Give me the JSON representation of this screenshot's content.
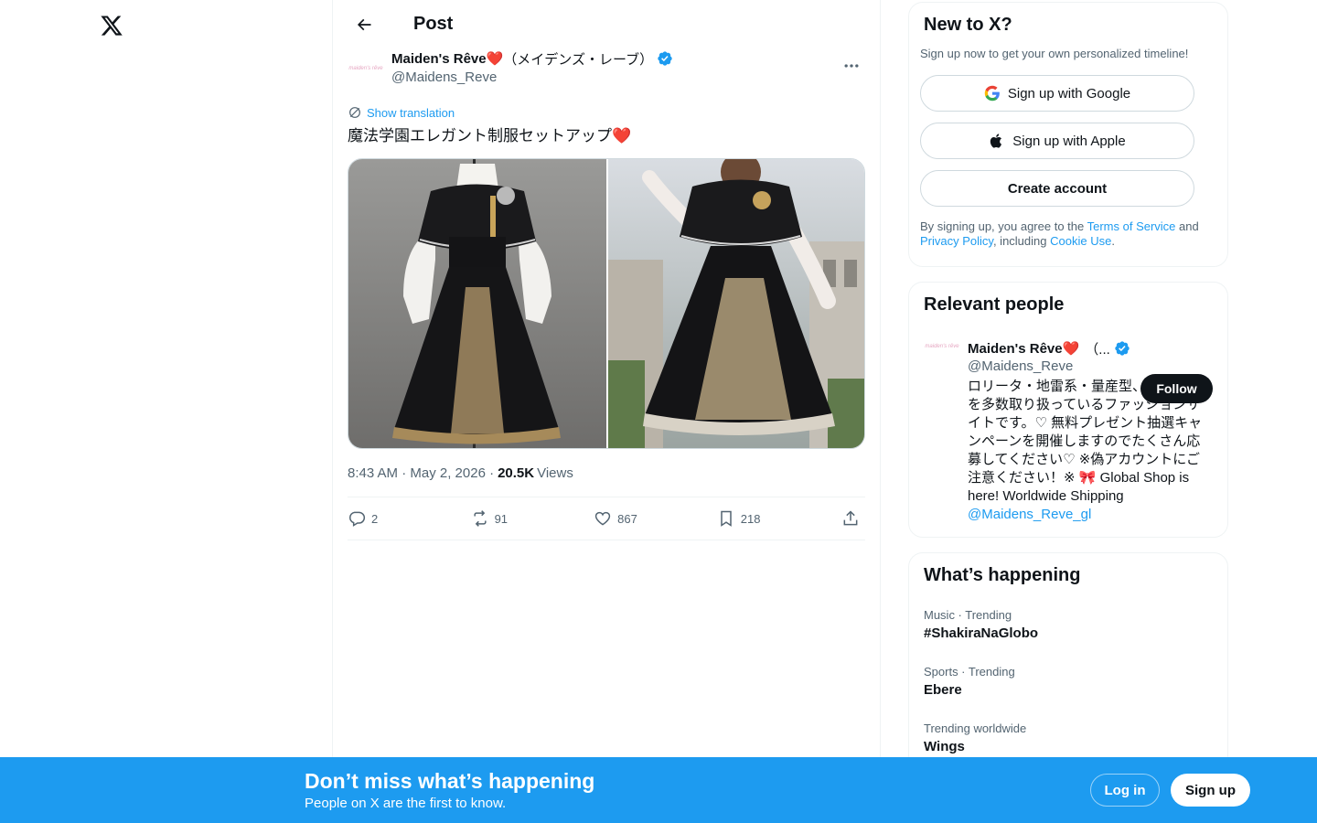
{
  "nav": {
    "logo_icon": "x-logo-icon"
  },
  "header": {
    "title": "Post",
    "back_icon": "arrow-left-icon"
  },
  "tweet": {
    "display_name": "Maiden's Rêve❤️",
    "display_name_suffix": "（メイデンズ・レーブ）",
    "handle": "@Maidens_Reve",
    "avatar_text": "maiden's rêve",
    "show_translation": "Show translation",
    "text": "魔法学園エレガント制服セットアップ❤️",
    "time": "8:43 AM · May 2, 2026 · ",
    "views_count": "20.5K",
    "views_label": "Views",
    "stats": {
      "replies": "2",
      "reposts": "91",
      "likes": "867",
      "bookmarks": "218"
    }
  },
  "signup": {
    "title": "New to X?",
    "subtitle": "Sign up now to get your own personalized timeline!",
    "google_label": "Sign up with Google",
    "apple_label": "Sign up with Apple",
    "create_label": "Create account",
    "legal_prefix": "By signing up, you agree to the ",
    "terms": "Terms of Service",
    "and": " and ",
    "privacy": "Privacy Policy",
    "including": ", including ",
    "cookie": "Cookie Use",
    "period": "."
  },
  "relevant": {
    "title": "Relevant people",
    "name": "Maiden's Rêve❤️",
    "name_rest": "（...",
    "handle": "@Maidens_Reve",
    "bio": "ロリータ・地雷系・量産型、可愛い服を多数取り扱っているファッションサイトです。♡ 無料プレゼント抽選キャンペーンを開催しますのでたくさん応募してください♡ ※偽アカウントにご注意ください！※ 🎀 Global Shop is here! Worldwide Shipping",
    "bio_link": "@Maidens_Reve_gl",
    "follow_label": "Follow"
  },
  "trends": {
    "title": "What’s happening",
    "items": [
      {
        "meta": "Music · Trending",
        "name": "#ShakiraNaGlobo"
      },
      {
        "meta": "Sports · Trending",
        "name": "Ebere"
      },
      {
        "meta": "Trending worldwide",
        "name": "Wings"
      }
    ]
  },
  "banner": {
    "title": "Don’t miss what’s happening",
    "subtitle": "People on X are the first to know.",
    "login_label": "Log in",
    "signup_label": "Sign up"
  },
  "colors": {
    "accent": "#1d9bf0",
    "text": "#0f1419",
    "muted": "#536471",
    "border": "#eff3f4"
  }
}
